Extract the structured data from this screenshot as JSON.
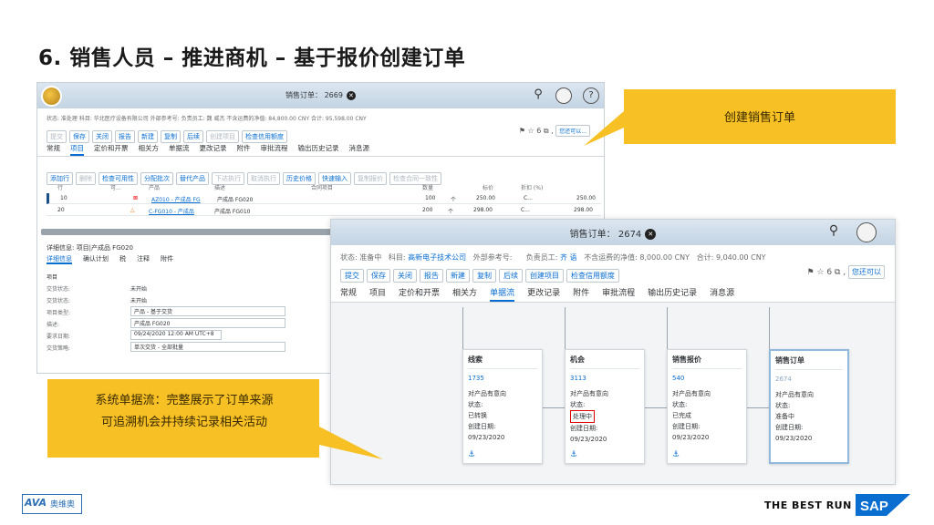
{
  "slide": {
    "title": "6. 销售人员 – 推进商机 – 基于报价创建订单",
    "callout_top": "创建销售订单",
    "callout_bottom_line1": "系统单据流：完整展示了订单来源",
    "callout_bottom_line2": "可追溯机会并持续记录相关活动",
    "footer_logo_a": "AVA",
    "footer_logo_b": "奥维奥",
    "footer_tagline": "THE BEST RUN",
    "footer_brand": "SAP",
    "colors": {
      "accent": "#0a6ed1",
      "callout": "#f7c024",
      "sap_blue": "#0a6ed1"
    }
  },
  "shot1": {
    "shell_title": "销售订单： 2669",
    "icons": [
      "logo-icon",
      "close-icon",
      "search-icon",
      "avatar",
      "help-icon"
    ],
    "status_line": "状态: 准处理  科目: 华北医疗设备有限公司  外部参考号:   负责员工: 魏 威杰  不含运费的净值: 84,800.00 CNY  合计: 95,598.00 CNY",
    "buttons": [
      "提交",
      "保存",
      "关闭",
      "报告",
      "新建",
      "复制",
      "后续",
      "创建项目",
      "检查信用额度"
    ],
    "right_tools": "⚑ ☆ 6 ⧉ ,",
    "right_button": "您还可以...",
    "tabs": [
      "常规",
      "项目",
      "定价和开票",
      "相关方",
      "单据流",
      "更改记录",
      "附件",
      "审批流程",
      "输出历史记录",
      "消息源"
    ],
    "active_tab": "项目",
    "toolbar": [
      "添加行",
      "删除",
      "检查可用性",
      "分配批次",
      "替代产品",
      "下达执行",
      "取消执行",
      "历史价格",
      "快速输入",
      "复制报价",
      "检查合同一致性"
    ],
    "table_headers": [
      "行",
      "可...",
      "产品",
      "描述",
      "合同项目",
      "数量",
      "标价",
      "折扣 (%)"
    ],
    "rows": [
      {
        "line": "10",
        "status": "red",
        "product": "AZ010 - 产成品 FG",
        "desc": "产成品 FG020",
        "qty": "100",
        "unit": "个",
        "price": "250.00",
        "cur": "C...",
        "total": "250.00"
      },
      {
        "line": "20",
        "status": "warn",
        "product": "C-FG010 - 产成品",
        "desc": "产成品 FG010",
        "qty": "200",
        "unit": "个",
        "price": "298.00",
        "cur": "C...",
        "total": "298.00"
      }
    ],
    "detail_title": "详细信息: 项目|产成品 FG020",
    "detail_tabs": [
      "详细信息",
      "确认计划",
      "税",
      "注释",
      "附件"
    ],
    "form": [
      {
        "label": "项目",
        "value": ""
      },
      {
        "label": "交货状态:",
        "value": "未开始"
      },
      {
        "label": "交货状态:",
        "value": "未开始"
      },
      {
        "label": "项目类型:",
        "value": "产品 - 基于交货"
      },
      {
        "label": "描述:",
        "value": "产成品 FG020"
      },
      {
        "label": "要求日期:",
        "value": "09/24/2020 12:00 AM UTC+8"
      },
      {
        "label": "交货策略:",
        "value": "单次交货 - 全部批量"
      }
    ]
  },
  "shot2": {
    "shell_title": "销售订单： 2674",
    "status_label": "状态: 准备中",
    "account_label": "科目: ",
    "account_value": "高新电子技术公司",
    "extref_label": "外部参考号:",
    "owner_label": "负责员工: ",
    "owner_value": "齐 语",
    "net_label": "不含运费的净值: 8,000.00 CNY",
    "total_label": "合计: 9,040.00 CNY",
    "buttons": [
      "提交",
      "保存",
      "关闭",
      "报告",
      "新建",
      "复制",
      "后续",
      "创建项目",
      "检查信用额度"
    ],
    "right_tools": "⚑ ☆ 6 ⧉ ,",
    "right_button": "您还可以",
    "tabs": [
      "常规",
      "项目",
      "定价和开票",
      "相关方",
      "单据流",
      "更改记录",
      "附件",
      "审批流程",
      "输出历史记录",
      "消息源"
    ],
    "active_tab": "单据流",
    "cards": [
      {
        "type": "线索",
        "number": "1735",
        "l1": "对产品有意向",
        "l2": "状态:",
        "l3": "已转换",
        "l4": "创建日期:",
        "l5": "09/23/2020"
      },
      {
        "type": "机会",
        "number": "3113",
        "l1": "对产品有意向",
        "l2": "状态:",
        "l3": "处理中",
        "l4": "创建日期:",
        "l5": "09/23/2020"
      },
      {
        "type": "销售报价",
        "number": "540",
        "l1": "对产品有意向",
        "l2": "状态:",
        "l3": "已完成",
        "l4": "创建日期:",
        "l5": "09/23/2020"
      },
      {
        "type": "销售订单",
        "number": "2674",
        "l1": "对产品有意向",
        "l2": "状态:",
        "l3": "准备中",
        "l4": "创建日期:",
        "l5": "09/23/2020"
      }
    ]
  }
}
